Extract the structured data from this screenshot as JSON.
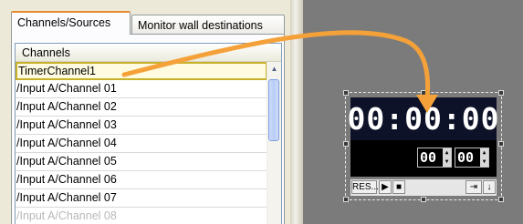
{
  "tabs": {
    "active_label": "Channels/Sources",
    "inactive_label": "Monitor wall destinations"
  },
  "list": {
    "header": "Channels",
    "selected_item": "TimerChannel1",
    "items": [
      "/Input A/Channel 01",
      "/Input A/Channel 02",
      "/Input A/Channel 03",
      "/Input A/Channel 04",
      "/Input A/Channel 05",
      "/Input A/Channel 06",
      "/Input A/Channel 07",
      "/Input A/Channel 08"
    ]
  },
  "timer": {
    "display": "00:00:00",
    "minutes": "00",
    "seconds": "00",
    "reset_label": "RES..."
  },
  "icons": {
    "scroll_up": "arrow-up-icon",
    "play": "play-icon",
    "stop": "stop-icon",
    "skip": "skip-to-end-icon",
    "down": "arrow-down-icon"
  },
  "colors": {
    "drag_arrow": "#f5a13a",
    "tab_accent": "#e68b2c",
    "timer_bg": "#0d1228",
    "workspace_bg": "#7b7b7b"
  }
}
